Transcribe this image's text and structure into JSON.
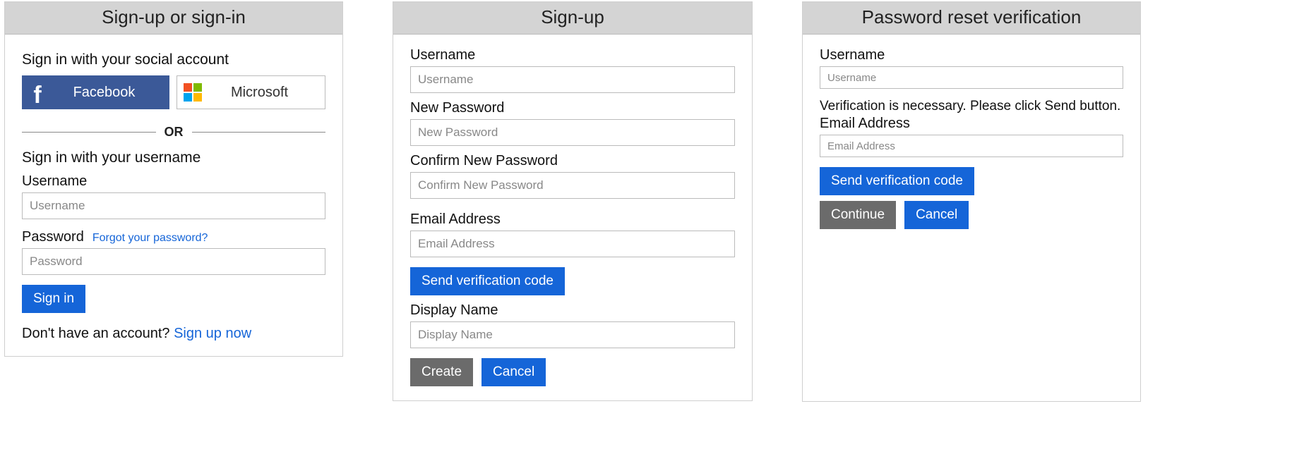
{
  "panels": {
    "signin": {
      "title": "Sign-up or sign-in",
      "social_heading": "Sign in with your social account",
      "facebook_label": "Facebook",
      "microsoft_label": "Microsoft",
      "or_label": "OR",
      "local_heading": "Sign in with your username",
      "username_label": "Username",
      "username_placeholder": "Username",
      "password_label": "Password",
      "forgot_link": "Forgot your password?",
      "password_placeholder": "Password",
      "signin_button": "Sign in",
      "signup_prompt": "Don't have an account?",
      "signup_link": "Sign up now"
    },
    "signup": {
      "title": "Sign-up",
      "username_label": "Username",
      "username_placeholder": "Username",
      "newpw_label": "New Password",
      "newpw_placeholder": "New Password",
      "confirmpw_label": "Confirm New Password",
      "confirmpw_placeholder": "Confirm New Password",
      "email_label": "Email Address",
      "email_placeholder": "Email Address",
      "send_code_button": "Send verification code",
      "display_label": "Display Name",
      "display_placeholder": "Display Name",
      "create_button": "Create",
      "cancel_button": "Cancel"
    },
    "reset": {
      "title": "Password reset verification",
      "username_label": "Username",
      "username_placeholder": "Username",
      "verify_msg": "Verification is necessary. Please click Send button.",
      "email_label": "Email Address",
      "email_placeholder": "Email Address",
      "send_code_button": "Send verification code",
      "continue_button": "Continue",
      "cancel_button": "Cancel"
    }
  }
}
